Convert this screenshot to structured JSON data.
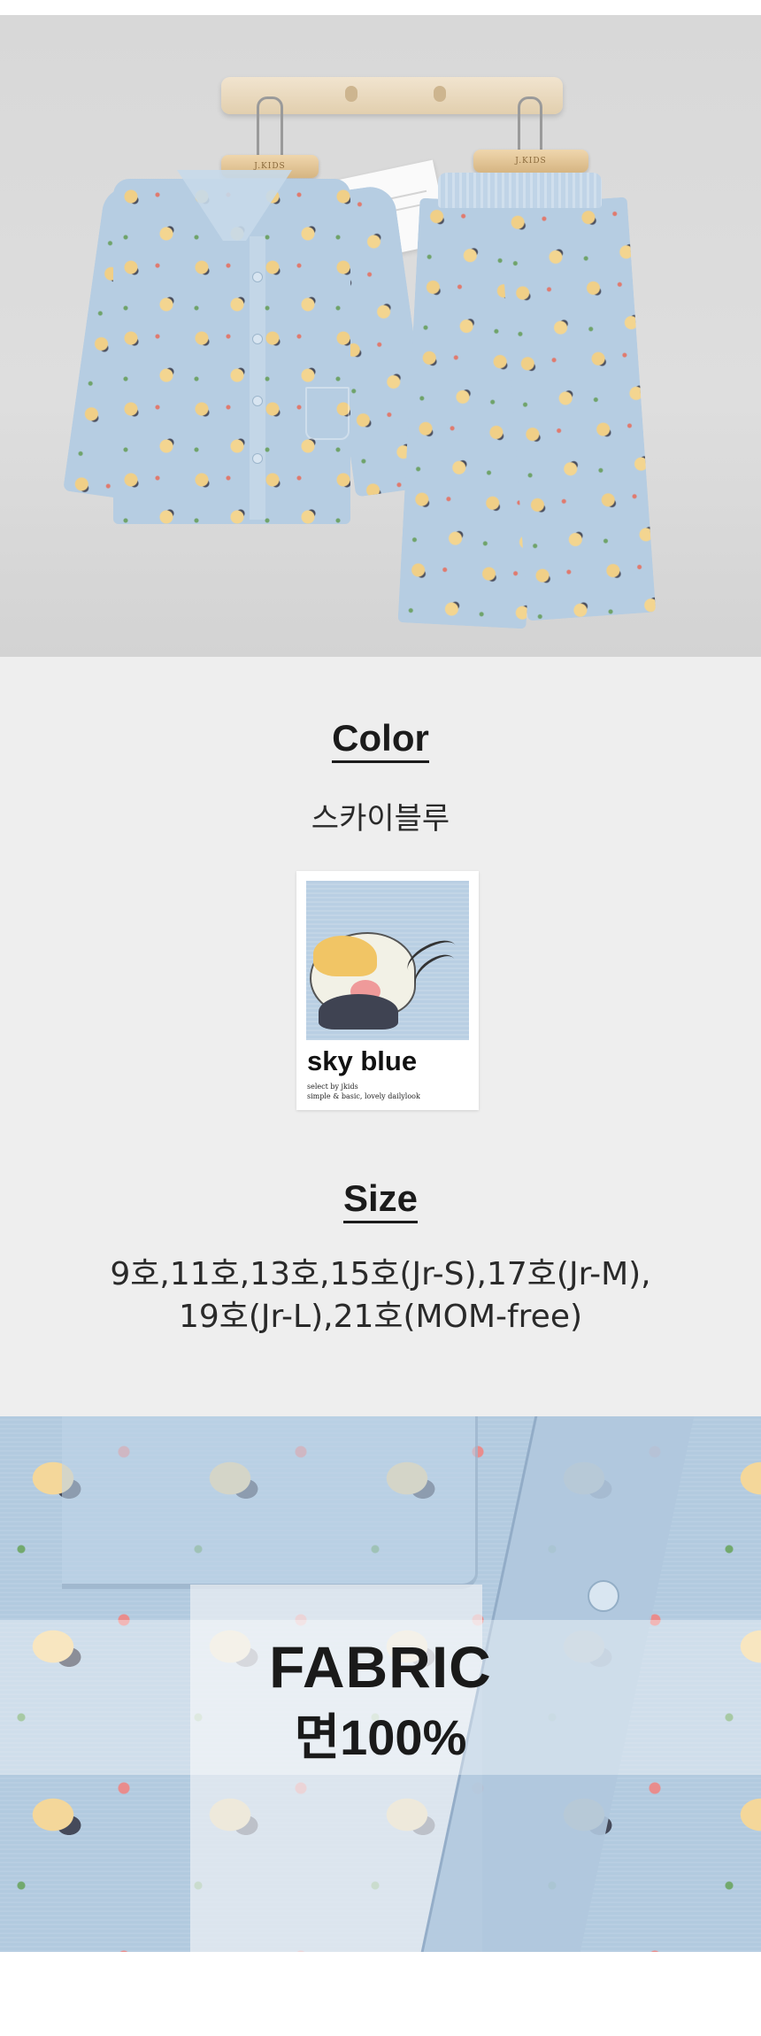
{
  "color_section": {
    "heading": "Color",
    "color_name": "스카이블루",
    "swatch": {
      "title": "sky blue",
      "line1": "select by jkids",
      "line2": "simple & basic, lovely dailylook",
      "color": "#b9cfe3"
    }
  },
  "size_section": {
    "heading": "Size",
    "line1": "9호,11호,13호,15호(Jr-S),17호(Jr-M),",
    "line2": "19호(Jr-L),21호(MOM-free)"
  },
  "fabric_section": {
    "title": "FABRIC",
    "composition": "면100%"
  },
  "hanger_brand": "J.KIDS",
  "colors": {
    "info_background": "#eeeeee",
    "fabric_blue": "#b2cadf",
    "text": "#1b1b1b"
  }
}
